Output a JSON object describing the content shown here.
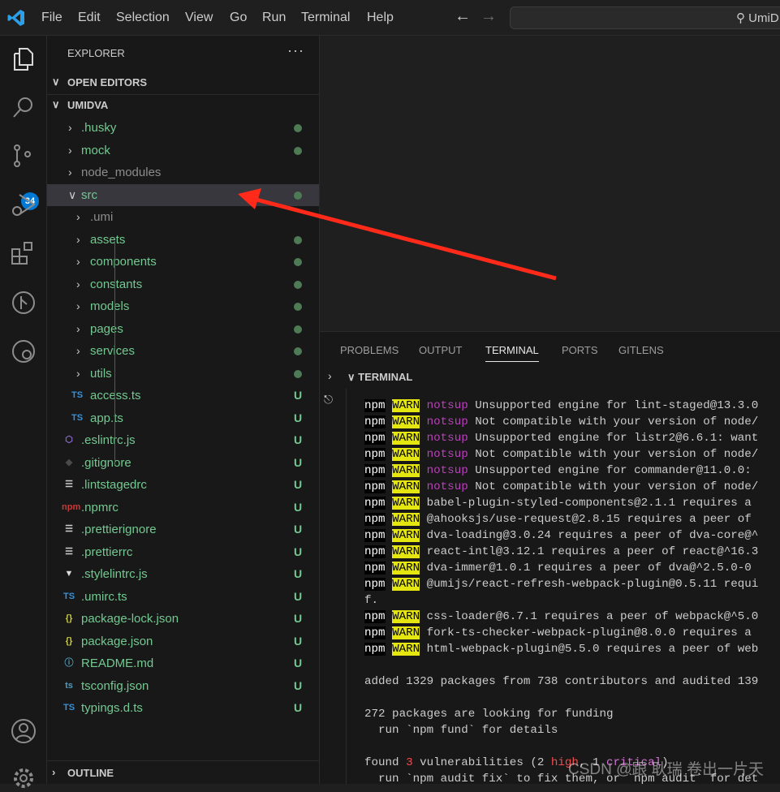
{
  "titlebar": {
    "menu": [
      "File",
      "Edit",
      "Selection",
      "View",
      "Go",
      "Run",
      "Terminal",
      "Help"
    ],
    "search_placeholder": "UmiD"
  },
  "activity": {
    "scm_badge": "34",
    "icons": [
      "files-icon",
      "search-icon",
      "source-control-icon",
      "run-debug-icon",
      "extensions-icon",
      "gitlens-icon",
      "remote-explorer-icon",
      "account-icon",
      "settings-gear-icon"
    ]
  },
  "explorer": {
    "title": "EXPLORER",
    "more": "···",
    "open_editors": "OPEN EDITORS",
    "project": "UMIDVA",
    "outline": "OUTLINE",
    "items": [
      {
        "name": ".husky",
        "type": "folder",
        "depth": 0,
        "status": "dot",
        "color": "#73c991"
      },
      {
        "name": "mock",
        "type": "folder",
        "depth": 0,
        "status": "dot",
        "color": "#73c991"
      },
      {
        "name": "node_modules",
        "type": "folder",
        "depth": 0,
        "status": "",
        "color": "#8c8c8c"
      },
      {
        "name": "src",
        "type": "folder-open",
        "depth": 0,
        "status": "dot",
        "color": "#73c991",
        "selected": true
      },
      {
        "name": ".umi",
        "type": "folder",
        "depth": 1,
        "status": "",
        "color": "#8c8c8c"
      },
      {
        "name": "assets",
        "type": "folder",
        "depth": 1,
        "status": "dot",
        "color": "#73c991"
      },
      {
        "name": "components",
        "type": "folder",
        "depth": 1,
        "status": "dot",
        "color": "#73c991"
      },
      {
        "name": "constants",
        "type": "folder",
        "depth": 1,
        "status": "dot",
        "color": "#73c991"
      },
      {
        "name": "models",
        "type": "folder",
        "depth": 1,
        "status": "dot",
        "color": "#73c991"
      },
      {
        "name": "pages",
        "type": "folder",
        "depth": 1,
        "status": "dot",
        "color": "#73c991"
      },
      {
        "name": "services",
        "type": "folder",
        "depth": 1,
        "status": "dot",
        "color": "#73c991"
      },
      {
        "name": "utils",
        "type": "folder",
        "depth": 1,
        "status": "dot",
        "color": "#73c991"
      },
      {
        "name": "access.ts",
        "type": "ts",
        "depth": 1,
        "status": "U",
        "color": "#73c991"
      },
      {
        "name": "app.ts",
        "type": "ts",
        "depth": 1,
        "status": "U",
        "color": "#73c991"
      },
      {
        "name": ".eslintrc.js",
        "type": "eslint",
        "depth": 0,
        "status": "U",
        "color": "#73c991"
      },
      {
        "name": ".gitignore",
        "type": "git",
        "depth": 0,
        "status": "U",
        "color": "#73c991"
      },
      {
        "name": ".lintstagedrc",
        "type": "lines",
        "depth": 0,
        "status": "U",
        "color": "#73c991"
      },
      {
        "name": ".npmrc",
        "type": "npm",
        "depth": 0,
        "status": "U",
        "color": "#73c991"
      },
      {
        "name": ".prettierignore",
        "type": "lines",
        "depth": 0,
        "status": "U",
        "color": "#73c991"
      },
      {
        "name": ".prettierrc",
        "type": "lines",
        "depth": 0,
        "status": "U",
        "color": "#73c991"
      },
      {
        "name": ".stylelintrc.js",
        "type": "stylelint",
        "depth": 0,
        "status": "U",
        "color": "#73c991"
      },
      {
        "name": ".umirc.ts",
        "type": "ts",
        "depth": 0,
        "status": "U",
        "color": "#73c991"
      },
      {
        "name": "package-lock.json",
        "type": "json",
        "depth": 0,
        "status": "U",
        "color": "#73c991"
      },
      {
        "name": "package.json",
        "type": "json",
        "depth": 0,
        "status": "U",
        "color": "#73c991"
      },
      {
        "name": "README.md",
        "type": "info",
        "depth": 0,
        "status": "U",
        "color": "#73c991"
      },
      {
        "name": "tsconfig.json",
        "type": "tsconfig",
        "depth": 0,
        "status": "U",
        "color": "#73c991"
      },
      {
        "name": "typings.d.ts",
        "type": "ts",
        "depth": 0,
        "status": "U",
        "color": "#73c991"
      }
    ]
  },
  "panel": {
    "tabs": [
      "PROBLEMS",
      "OUTPUT",
      "TERMINAL",
      "PORTS",
      "GITLENS"
    ],
    "active_tab": "TERMINAL",
    "terminal_header": "TERMINAL"
  },
  "terminal": {
    "lines": [
      {
        "npm": "npm",
        "warn": "WARN",
        "tag": "notsup",
        "text": " Unsupported engine for lint-staged@13.3.0"
      },
      {
        "npm": "npm",
        "warn": "WARN",
        "tag": "notsup",
        "text": " Not compatible with your version of node/"
      },
      {
        "npm": "npm",
        "warn": "WARN",
        "tag": "notsup",
        "text": " Unsupported engine for listr2@6.6.1: want"
      },
      {
        "npm": "npm",
        "warn": "WARN",
        "tag": "notsup",
        "text": " Not compatible with your version of node/"
      },
      {
        "npm": "npm",
        "warn": "WARN",
        "tag": "notsup",
        "text": " Unsupported engine for commander@11.0.0:"
      },
      {
        "npm": "npm",
        "warn": "WARN",
        "tag": "notsup",
        "text": " Not compatible with your version of node/"
      },
      {
        "npm": "npm",
        "warn": "WARN",
        "tag": "",
        "text": "babel-plugin-styled-components@2.1.1 requires a"
      },
      {
        "npm": "npm",
        "warn": "WARN",
        "tag": "",
        "text": "@ahooksjs/use-request@2.8.15 requires a peer of"
      },
      {
        "npm": "npm",
        "warn": "WARN",
        "tag": "",
        "text": "dva-loading@3.0.24 requires a peer of dva-core@^"
      },
      {
        "npm": "npm",
        "warn": "WARN",
        "tag": "",
        "text": "react-intl@3.12.1 requires a peer of react@^16.3"
      },
      {
        "npm": "npm",
        "warn": "WARN",
        "tag": "",
        "text": "dva-immer@1.0.1 requires a peer of dva@^2.5.0-0"
      },
      {
        "npm": "npm",
        "warn": "WARN",
        "tag": "",
        "text": "@umijs/react-refresh-webpack-plugin@0.5.11 requi"
      },
      {
        "text": "f."
      },
      {
        "npm": "npm",
        "warn": "WARN",
        "tag": "",
        "text": "css-loader@6.7.1 requires a peer of webpack@^5.0"
      },
      {
        "npm": "npm",
        "warn": "WARN",
        "tag": "",
        "text": "fork-ts-checker-webpack-plugin@8.0.0 requires a"
      },
      {
        "npm": "npm",
        "warn": "WARN",
        "tag": "",
        "text": "html-webpack-plugin@5.5.0 requires a peer of web"
      },
      {
        "text": ""
      },
      {
        "text": "added 1329 packages from 738 contributors and audited 139"
      },
      {
        "text": ""
      },
      {
        "text": "272 packages are looking for funding"
      },
      {
        "text": "  run `npm fund` for details"
      },
      {
        "text": ""
      }
    ],
    "vuln": {
      "pre": "found ",
      "count": "3",
      "mid": " vulnerabilities (2 ",
      "high": "high",
      "sep": ", 1 ",
      "critical": "critical",
      "post": ")"
    },
    "last": "  run `npm audit fix` to fix them, or `npm audit` for det"
  },
  "watermark": "CSDN @跟 耿瑞 卷出一片天",
  "colors": {
    "accent": "#0078d4",
    "annotation_arrow": "#ff2a1a",
    "git_untracked": "#73c991"
  }
}
